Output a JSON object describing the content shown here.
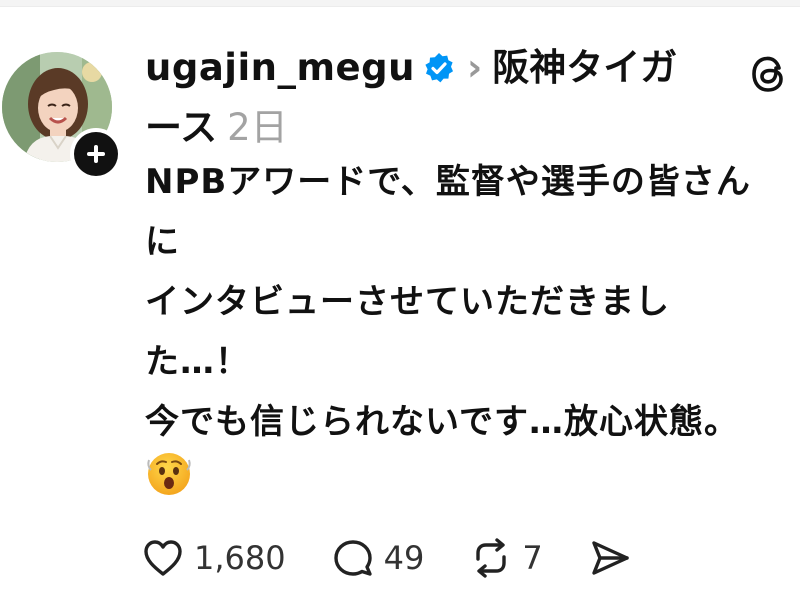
{
  "post": {
    "author": {
      "username": "ugajin_megu",
      "verified": true,
      "topic_line1": "阪神タイガ",
      "topic_line2": "ース",
      "timestamp": "2日"
    },
    "body_lines": [
      "NPBアワードで、監督や選手の皆さん",
      "に",
      "インタビューさせていただきまし",
      "た…！",
      "今でも信じられないです…放心状態。"
    ],
    "emoji_name": "hushed-face-emoji",
    "actions": {
      "likes": "1,680",
      "replies": "49",
      "reposts": "7"
    }
  },
  "icons": {
    "verified": "verified-badge-icon",
    "chevron": "chevron-right-icon",
    "threads": "threads-logo-icon",
    "follow": "plus-icon",
    "like": "heart-icon",
    "reply": "comment-icon",
    "repost": "repost-icon",
    "share": "send-icon"
  },
  "colors": {
    "text": "#111111",
    "muted": "#a3a3a3",
    "verified": "#0095f6"
  }
}
